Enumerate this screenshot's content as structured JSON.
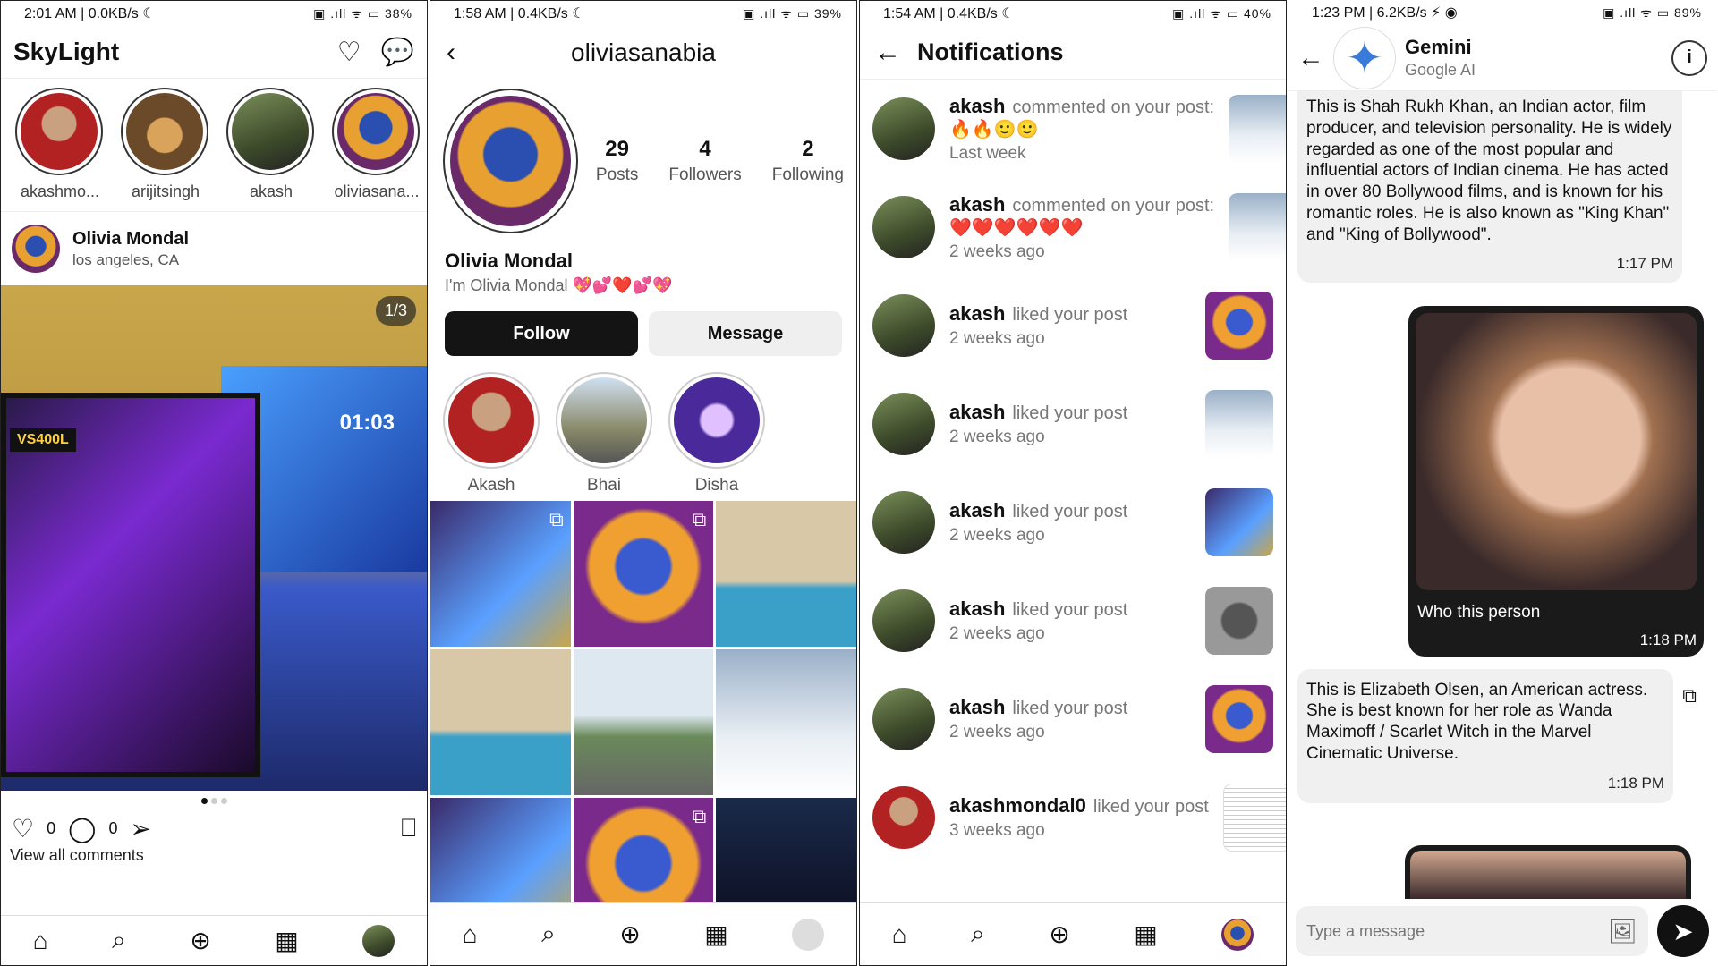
{
  "feed": {
    "status": {
      "left": "2:01 AM | 0.0KB/s ☾",
      "right": "▣ .ıll ᯤ ▭ 38%"
    },
    "app_title": "SkyLight",
    "stories": [
      {
        "label": "akashmo..."
      },
      {
        "label": "arijitsingh"
      },
      {
        "label": "akash"
      },
      {
        "label": "oliviasana..."
      }
    ],
    "post": {
      "author": "Olivia Mondal",
      "location": "los angeles, CA",
      "image_counter": "1/3",
      "image_time": "01:03",
      "image_psu": "VS400L",
      "likes": "0",
      "comments": "0",
      "view_comments": "View all comments"
    }
  },
  "profile": {
    "status": {
      "left": "1:58 AM | 0.4KB/s ☾",
      "right": "▣ .ıll ᯤ ▭ 39%"
    },
    "username": "oliviasanabia",
    "stats": [
      {
        "num": "29",
        "label": "Posts"
      },
      {
        "num": "4",
        "label": "Followers"
      },
      {
        "num": "2",
        "label": "Following"
      }
    ],
    "name": "Olivia Mondal",
    "bio": "I'm Olivia Mondal 💖💕❤️💕💖",
    "follow_label": "Follow",
    "message_label": "Message",
    "highlights": [
      {
        "label": "Akash"
      },
      {
        "label": "Bhai"
      },
      {
        "label": "Disha"
      }
    ]
  },
  "notifications": {
    "status": {
      "left": "1:54 AM | 0.4KB/s ☾",
      "right": "▣ .ıll ᯤ ▭ 40%"
    },
    "title": "Notifications",
    "items": [
      {
        "user": "akash",
        "action": "commented on your post:",
        "emoji": "🔥🔥🙂🙂",
        "time": "Last week"
      },
      {
        "user": "akash",
        "action": "commented on your post:",
        "emoji": "❤️❤️❤️❤️❤️❤️",
        "time": "2 weeks ago"
      },
      {
        "user": "akash",
        "action": "liked your post",
        "time": "2 weeks ago"
      },
      {
        "user": "akash",
        "action": "liked your post",
        "time": "2 weeks ago"
      },
      {
        "user": "akash",
        "action": "liked your post",
        "time": "2 weeks ago"
      },
      {
        "user": "akash",
        "action": "liked your post",
        "time": "2 weeks ago"
      },
      {
        "user": "akash",
        "action": "liked your post",
        "time": "2 weeks ago"
      },
      {
        "user": "akashmondal0",
        "action": "liked your post",
        "time": "3 weeks ago"
      }
    ]
  },
  "chat": {
    "status": {
      "left": "1:23 PM | 6.2KB/s ⚡ ◉",
      "right": "▣ .ıll ᯤ ▭ 89%"
    },
    "bot_name": "Gemini",
    "bot_sub": "Google AI",
    "msg1": "This is Shah Rukh Khan, an Indian actor, film producer, and television personality. He is widely regarded as one of the most popular and influential actors of Indian cinema.  He has acted in over 80 Bollywood films, and is known for his romantic roles. He is also known as \"King Khan\" and \"King of Bollywood\".",
    "msg1_time": "1:17 PM",
    "msg2": "Who this person",
    "msg2_time": "1:18 PM",
    "msg3": "This is Elizabeth Olsen, an American actress. She is best known for her role as Wanda Maximoff / Scarlet Witch in the Marvel Cinematic Universe.",
    "msg3_time": "1:18 PM",
    "input_placeholder": "Type a message"
  }
}
